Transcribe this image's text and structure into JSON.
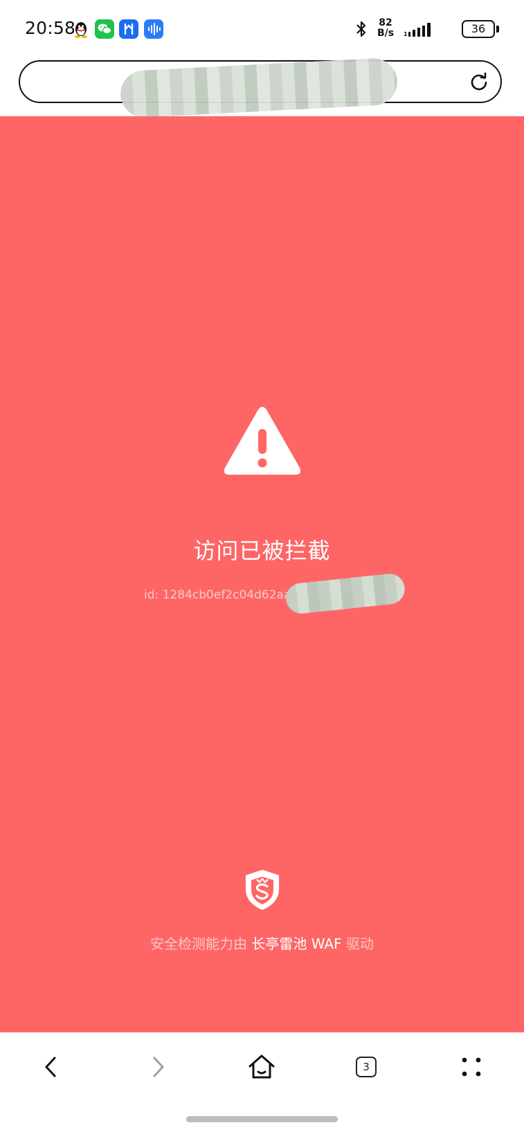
{
  "status_bar": {
    "time": "20:58",
    "net_speed_value": "82",
    "net_speed_unit": "B/s",
    "battery": "36"
  },
  "blocked_page": {
    "title": "访问已被拦截",
    "id_text": "id: 1284cb0ef2c04d62aaf",
    "footer_prefix": "安全检测能力由",
    "footer_brand": "长亭雷池 WAF",
    "footer_suffix": "驱动"
  },
  "bottom_nav": {
    "tab_count": "3"
  },
  "colors": {
    "page_background": "#fe6666",
    "foreground": "#ffffff"
  },
  "icons": {
    "warning": "warning-triangle-icon",
    "waf_logo": "shield-logo-icon",
    "reload": "reload-icon",
    "back": "chevron-left-icon",
    "forward": "chevron-right-icon",
    "home": "home-icon",
    "menu": "four-dots-menu-icon"
  }
}
